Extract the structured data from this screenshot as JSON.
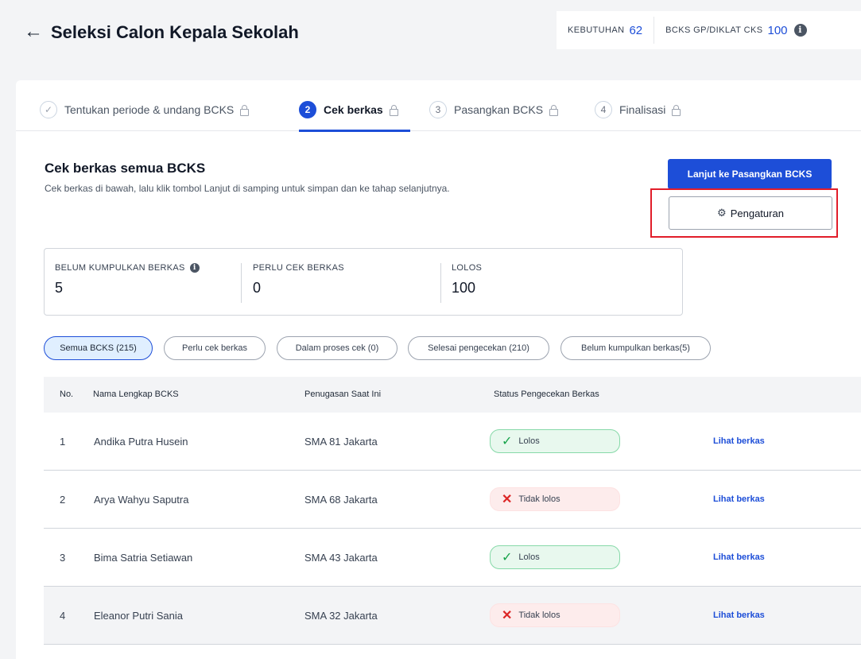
{
  "header": {
    "title": "Seleksi Calon Kepala Sekolah",
    "stats": [
      {
        "label": "KEBUTUHAN",
        "value": "62"
      },
      {
        "label": "BCKS GP/DIKLAT CKS",
        "value": "100"
      }
    ]
  },
  "stepper": {
    "steps": [
      {
        "number": "✓",
        "label": "Tentukan periode & undang BCKS",
        "state": "done"
      },
      {
        "number": "2",
        "label": "Cek berkas",
        "state": "active"
      },
      {
        "number": "3",
        "label": "Pasangkan BCKS",
        "state": "pending"
      },
      {
        "number": "4",
        "label": "Finalisasi",
        "state": "pending"
      }
    ]
  },
  "section": {
    "title": "Cek berkas semua BCKS",
    "description": "Cek berkas di bawah, lalu klik tombol Lanjut di samping untuk simpan dan ke tahap selanjutnya."
  },
  "actions": {
    "primary": "Lanjut ke Pasangkan BCKS",
    "settings": "Pengaturan"
  },
  "summary": [
    {
      "label": "BELUM KUMPULKAN BERKAS",
      "value": "5"
    },
    {
      "label": "PERLU CEK BERKAS",
      "value": "0"
    },
    {
      "label": "LOLOS",
      "value": "100"
    }
  ],
  "filters": [
    "Semua BCKS (215)",
    "Perlu  cek berkas",
    "Dalam proses cek (0)",
    "Selesai pengecekan (210)",
    "Belum kumpulkan berkas(5)"
  ],
  "table": {
    "headers": [
      "No.",
      "Nama Lengkap BCKS",
      "Penugasan Saat Ini",
      "Status Pengecekan Berkas"
    ],
    "rows": [
      {
        "no": "1",
        "name": "Andika Putra Husein",
        "place": "SMA 81 Jakarta",
        "status": "Lolos",
        "link": "Lihat berkas"
      },
      {
        "no": "2",
        "name": "Arya Wahyu Saputra",
        "place": "SMA 68 Jakarta",
        "status": "Tidak lolos",
        "link": "Lihat berkas"
      },
      {
        "no": "3",
        "name": "Bima Satria Setiawan",
        "place": "SMA 43 Jakarta",
        "status": "Lolos",
        "link": "Lihat berkas"
      },
      {
        "no": "4",
        "name": "Eleanor Putri Sania",
        "place": "SMA 32 Jakarta",
        "status": "Tidak lolos",
        "link": "Lihat berkas"
      }
    ]
  },
  "colors": {
    "accent": "#1d4ed8",
    "highlight": "#e11d2a",
    "pass_bg": "#e8f8ee",
    "fail_bg": "#fdecec"
  }
}
